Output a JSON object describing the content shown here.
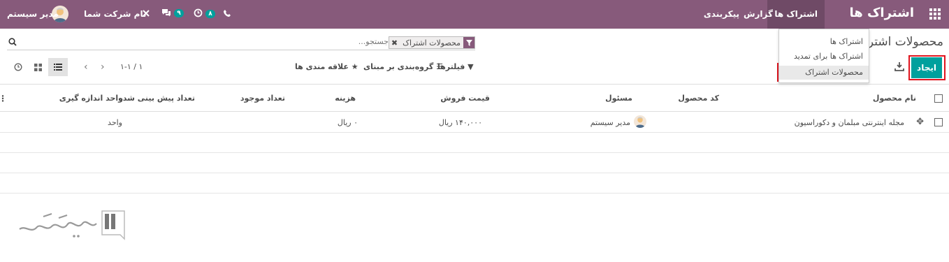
{
  "navbar": {
    "app_title": "اشتراک ها",
    "menu": [
      {
        "label": "اشتراک ها",
        "active": true
      },
      {
        "label": "گزارش",
        "active": false
      },
      {
        "label": "پیکربندی",
        "active": false
      }
    ],
    "company_name": "نام شرکت شما",
    "user_name": "مدیر سیستم",
    "messages_count": "۹",
    "activities_count": "۸"
  },
  "dropdown": {
    "items": [
      "اشتراک ها",
      "اشتراک ها برای تمدید",
      "محصولات اشتراک"
    ],
    "selected": "محصولات اشتراک"
  },
  "control_panel": {
    "breadcrumb": "محصولات اشتراک",
    "facet_label": "محصولات اشتراک",
    "search_placeholder": "جستجو...",
    "create_label": "ایجاد",
    "filters_label": "فیلترها",
    "groupby_label": "گروه‌بندی بر مبنای",
    "favorites_label": "علاقه مندی ها",
    "pager": "۱-۱ / ۱"
  },
  "table": {
    "columns": [
      "نام محصول",
      "کد محصول",
      "مسئول",
      "قیمت فروش",
      "هزینه",
      "تعداد موجود",
      "تعداد پیش بینی شده",
      "واحد اندازه گیری"
    ],
    "rows": [
      {
        "name": "مجله اینترنتی مبلمان و دکوراسیون",
        "code": "",
        "responsible": "مدیر سیستم",
        "price": "۱۴۰,۰۰۰ ریال",
        "cost": "۰ ریال",
        "qty": "",
        "forecast": "",
        "uom": "واحد"
      }
    ]
  },
  "colors": {
    "navbar": "#875a7b",
    "primary_button": "#00a09d",
    "highlight": "#e0141e"
  }
}
